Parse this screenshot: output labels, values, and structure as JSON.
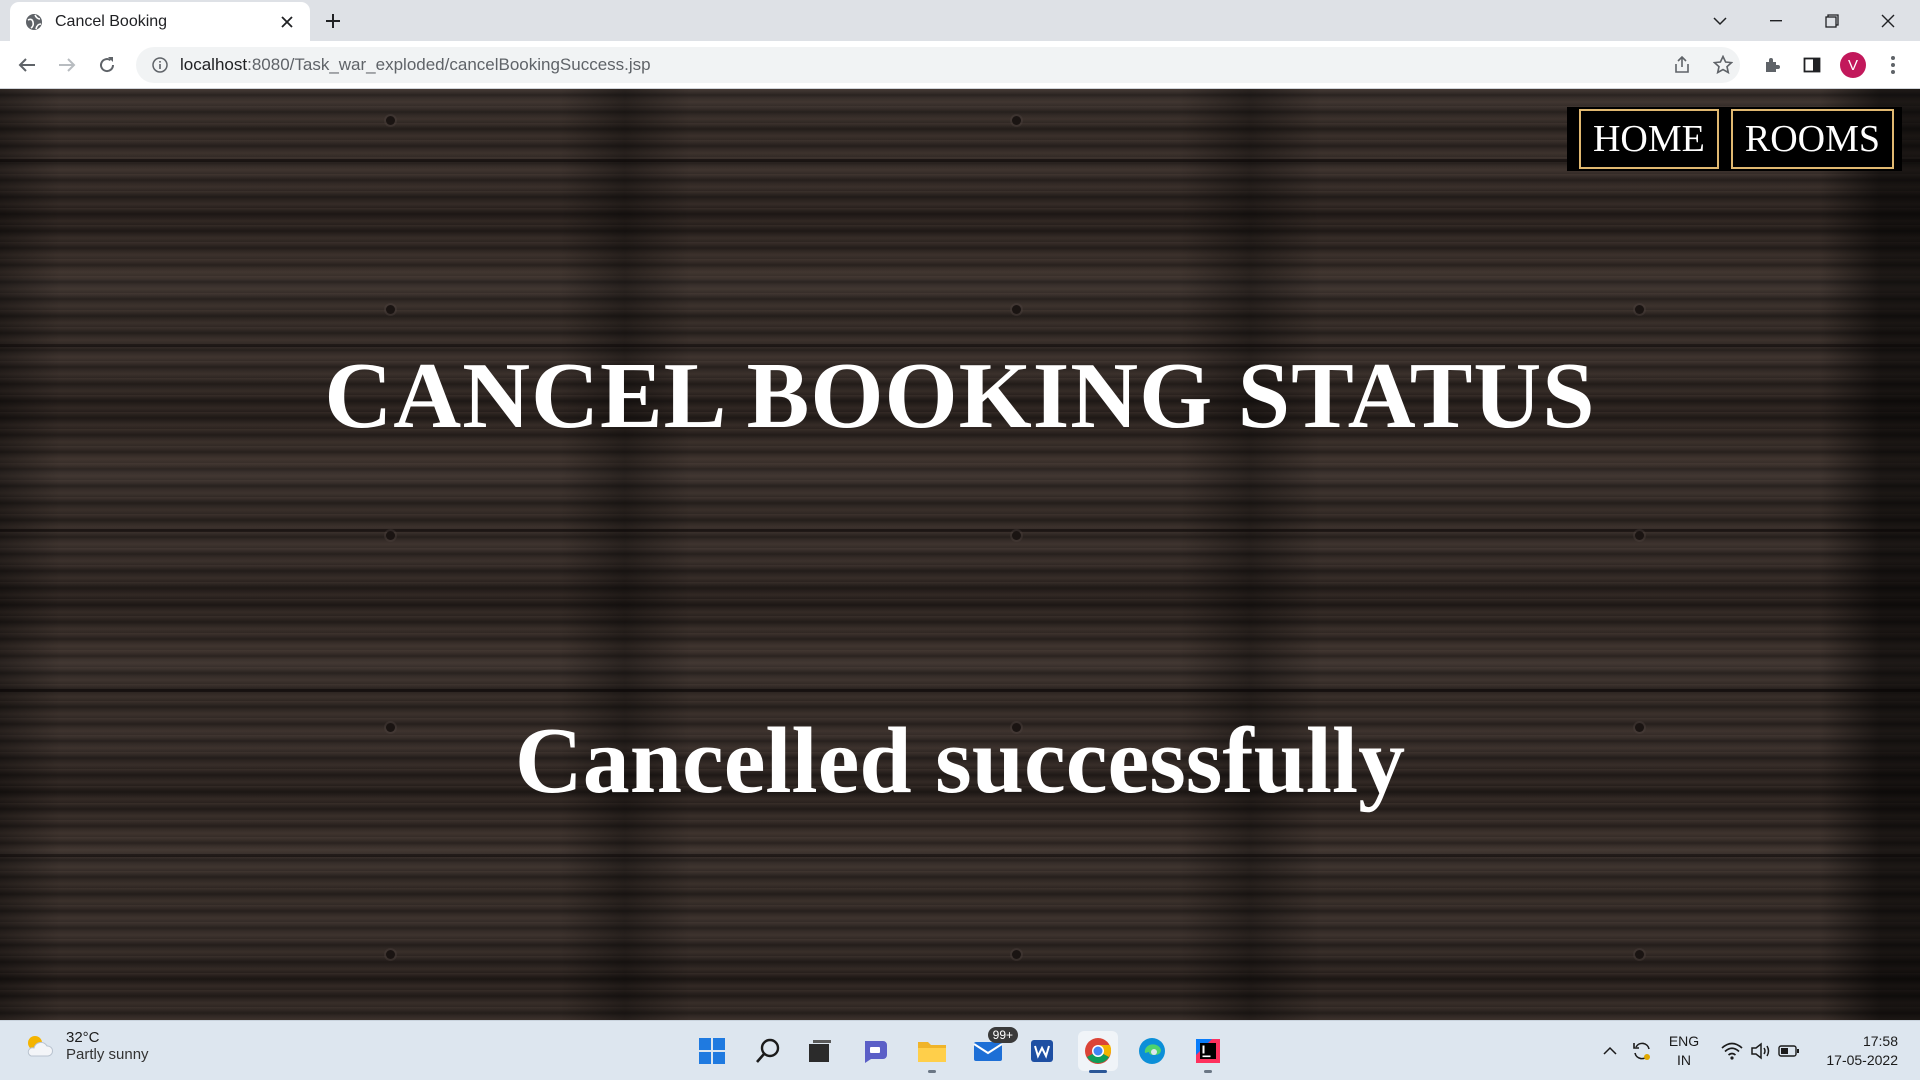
{
  "browser": {
    "tab_title": "Cancel Booking",
    "url_host": "localhost",
    "url_rest": ":8080/Task_war_exploded/cancelBookingSuccess.jsp"
  },
  "page": {
    "nav": [
      {
        "label": "HOME"
      },
      {
        "label": "ROOMS"
      }
    ],
    "heading": "CANCEL BOOKING STATUS",
    "message": "Cancelled successfully",
    "accent": "#e0b870"
  },
  "taskbar": {
    "weather_temp": "32°C",
    "weather_condition": "Partly sunny",
    "mail_badge": "99+",
    "lang_line1": "ENG",
    "lang_line2": "IN",
    "time": "17:58",
    "date": "17-05-2022"
  },
  "profile_initial": "V"
}
